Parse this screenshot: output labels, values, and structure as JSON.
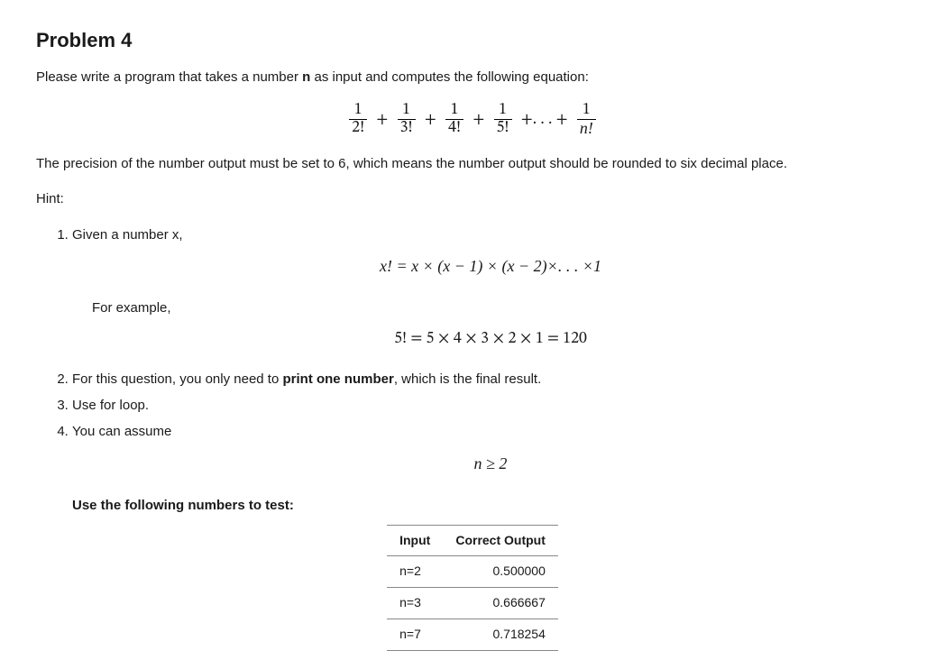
{
  "title": "Problem 4",
  "intro_pre": "Please write a program that takes a number ",
  "intro_var": "n",
  "intro_post": " as input and computes the following equation:",
  "eq_main": {
    "terms": [
      {
        "num": "1",
        "den": "2!"
      },
      {
        "num": "1",
        "den": "3!"
      },
      {
        "num": "1",
        "den": "4!"
      },
      {
        "num": "1",
        "den": "5!"
      }
    ],
    "dots": "+. . . +",
    "last": {
      "num": "1",
      "den": "n!"
    }
  },
  "precision": "The precision of the number output must be set to 6, which means the number output should be rounded to six decimal place.",
  "hint_label": "Hint:",
  "hint1": "Given a number x,",
  "eq_factorial": "x! = x × (x − 1) × (x − 2)×. . . ×1",
  "for_example": "For example,",
  "eq_example": "5! = 5 × 4 × 3 × 2 × 1 = 120",
  "hint2_pre": "For this question, you only need to ",
  "hint2_bold": "print one number",
  "hint2_post": ", which is the final result.",
  "hint3": "Use for loop.",
  "hint4": "You can assume",
  "eq_assume": "n ≥ 2",
  "test_label": "Use the following numbers to test:",
  "table": {
    "head": [
      "Input",
      "Correct Output"
    ],
    "rows": [
      {
        "input": "n=2",
        "output": "0.500000"
      },
      {
        "input": "n=3",
        "output": "0.666667"
      },
      {
        "input": "n=7",
        "output": "0.718254"
      }
    ]
  }
}
